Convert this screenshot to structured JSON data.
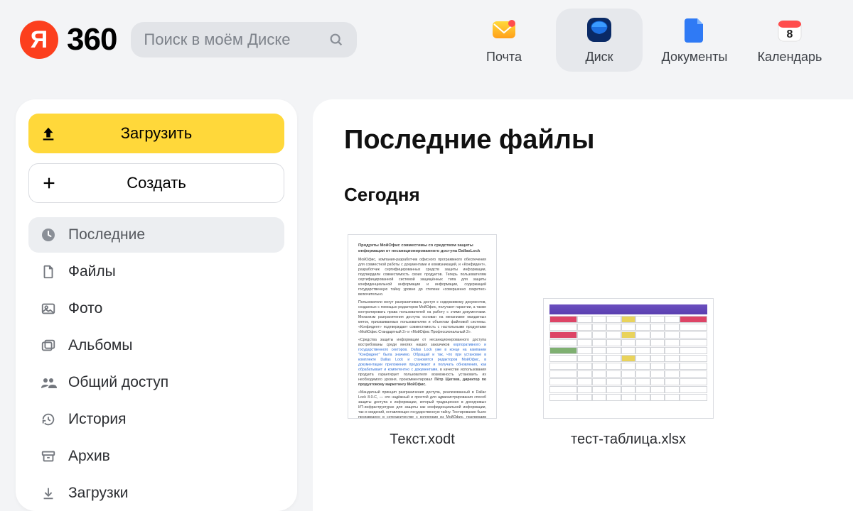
{
  "brand": {
    "ya_letter": "Я",
    "suffix": "360"
  },
  "search": {
    "placeholder": "Поиск в моём Диске"
  },
  "top_nav": [
    {
      "label": "Почта",
      "icon": "mail"
    },
    {
      "label": "Диск",
      "icon": "disk",
      "active": true
    },
    {
      "label": "Документы",
      "icon": "docs"
    },
    {
      "label": "Календарь",
      "icon": "calendar",
      "badge": "8"
    }
  ],
  "sidebar": {
    "upload_label": "Загрузить",
    "create_label": "Создать",
    "items": [
      {
        "label": "Последние",
        "icon": "clock",
        "active": true
      },
      {
        "label": "Файлы",
        "icon": "file"
      },
      {
        "label": "Фото",
        "icon": "photo"
      },
      {
        "label": "Альбомы",
        "icon": "album"
      },
      {
        "label": "Общий доступ",
        "icon": "shared"
      },
      {
        "label": "История",
        "icon": "history"
      },
      {
        "label": "Архив",
        "icon": "archive"
      },
      {
        "label": "Загрузки",
        "icon": "download"
      }
    ]
  },
  "main": {
    "title": "Последние файлы",
    "section": "Сегодня",
    "files": [
      {
        "name": "Текст.xodt"
      },
      {
        "name": "тест-таблица.xlsx"
      }
    ]
  }
}
